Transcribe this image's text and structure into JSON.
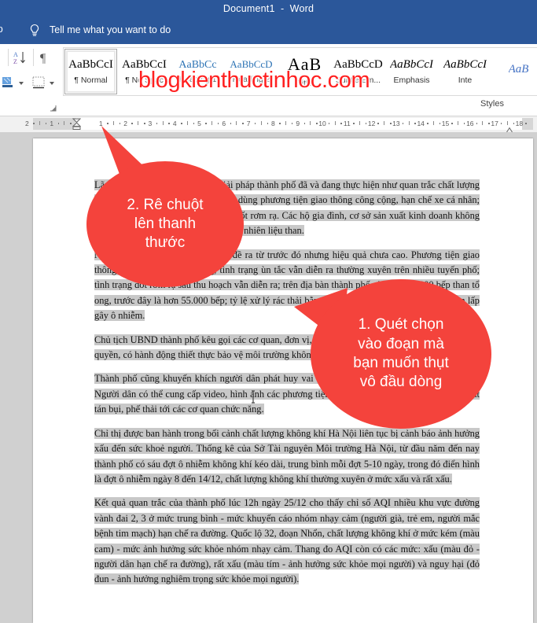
{
  "titlebar": {
    "title": "Document1  -  Word"
  },
  "tellme": {
    "help_tab_label": "lp",
    "bulb_icon": "lightbulb-icon",
    "placeholder": "Tell me what you want to do"
  },
  "ribbon": {
    "group_caption": "Styles",
    "left_icons": [
      {
        "name": "sort-az-icon",
        "label": "Sort"
      },
      {
        "name": "show-formatting-marks-icon",
        "label": "¶"
      },
      {
        "name": "shading-icon",
        "label": "Shading"
      },
      {
        "name": "borders-icon",
        "label": "Borders"
      }
    ],
    "styles": [
      {
        "preview": "AaBbCcI",
        "label": "¶ Normal",
        "variant": "normal",
        "selected": true
      },
      {
        "preview": "AaBbCcI",
        "label": "¶ No Spac",
        "variant": "normal",
        "selected": false
      },
      {
        "preview": "AaBbCc",
        "label": "Heading 1",
        "variant": "heading1",
        "selected": false
      },
      {
        "preview": "AaBbCcD",
        "label": "Heading 2",
        "variant": "heading2",
        "selected": false
      },
      {
        "preview": "AaB",
        "label": "Title",
        "variant": "title",
        "selected": false
      },
      {
        "preview": "AaBbCcD",
        "label": "Subtle Em...",
        "variant": "normal",
        "selected": false
      },
      {
        "preview": "AaBbCcI",
        "label": "Emphasis",
        "variant": "italic",
        "selected": false
      },
      {
        "preview": "AaBbCcI",
        "label": "Inte",
        "variant": "italic",
        "selected": false
      },
      {
        "preview": "AaB",
        "label": "",
        "variant": "blue",
        "selected": false
      }
    ]
  },
  "ruler": {
    "left_numbers": [
      "2",
      "1"
    ],
    "numbers": [
      "1",
      "2",
      "3",
      "4",
      "5",
      "6",
      "7",
      "8",
      "9",
      "10",
      "11",
      "12",
      "13",
      "14",
      "15",
      "16",
      "17",
      "18"
    ],
    "first_line_indent_marker": "hourglass-indent-marker",
    "right_indent_marker": "right-indent-marker"
  },
  "document": {
    "paragraphs": [
      "Lãnh đạo thành phố nêu những giải pháp thành phố đã và đang thực hiện như quan trắc chất lượng không khí; khuyến khích người dân dùng phương tiện giao thông công cộng, hạn chế xe cá nhân; vận động người dân không đốt rác, đốt rơm rạ. Các hộ gia đình, cơ sở sản xuất kinh doanh không sử dụng bếp than tổ ong hoặc các loại nhiên liệu than.",
      "Nhưng nhiều giải pháp thành phố đề ra từ trước đó nhưng hiệu quả chưa cao. Phương tiện giao thông cá nhân ngày càng tăng, tình trạng ùn tắc vẫn diễn ra thường xuyên trên nhiều tuyến phố; tình trạng đốt rơm rạ sau thu hoạch vẫn diễn ra; trên địa bàn thành phố còn trên 22.000 bếp than tổ ong, trước đây là hơn 55.000 bếp; tỷ lệ xử lý rác thải bằng chôn lấp vẫn chiếm đa số, nơi chôn lấp gây ô nhiễm.",
      "Chủ tịch UBND thành phố kêu gọi các cơ quan, đơn vị, người dân ủng hộ các biện pháp của chính quyền, có hành động thiết thực bảo vệ môi trường không khí của thành phố.",
      "Thành phố cũng khuyến khích người dân phát huy vai trò giám sát các hoạt động gây ô nhiễm. Người dân có thể cung cấp video, hình ảnh các phương tiện chở vật liệu không che chắn gây phát tán bụi, phế thải tới các cơ quan chức năng.",
      "Chỉ thị được ban hành trong bối cảnh chất lượng không khí Hà Nội liên tục bị cảnh báo ảnh hưởng xấu đến sức khoẻ người. Thống kê của Sở Tài nguyên Môi trường Hà Nội, từ đầu năm đến nay thành phố có sáu đợt ô nhiễm không khí kéo dài, trung bình mỗi đợt 5-10 ngày, trong đó điển hình là đợt ô nhiễm ngày 8 đến 14/12, chất lượng không khí thường xuyên ở mức xấu và rất xấu.",
      "Kết quả quan trắc của thành phố lúc 12h ngày 25/12 cho thấy chỉ số AQI nhiều khu vực đường vành đai 2, 3 ở mức trung bình - mức khuyến cáo nhóm nhạy cảm (người già, trẻ em, người mắc bệnh tim mạch) hạn chế ra đường. Quốc lộ 32, đoạn Nhổn, chất lượng không khí ở mức kém (màu cam) - mức ảnh hưởng sức khỏe nhóm nhạy cảm. Thang đo AQI còn có các mức: xấu (màu đỏ - người dân hạn chế ra đường), rất xấu (màu tím - ảnh hưởng sức khỏe mọi người) và nguy hại (đỏ đun - ảnh hưởng nghiêm trọng sức khỏe mọi người)."
    ],
    "cursor_icon": "text-ibeam-cursor"
  },
  "callouts": [
    {
      "id": "callout-2",
      "text": "2. Rê chuột\nlên thanh\nthước",
      "color": "#f4433c"
    },
    {
      "id": "callout-1",
      "text": "1. Quét chọn\nvào đoạn mà\nbạn muốn thụt\nvô đầu dòng",
      "color": "#f4433c"
    }
  ],
  "watermark": {
    "text": "blogkienthuctinhoc.com",
    "color": "#ff2020"
  },
  "colors": {
    "titlebar_bg": "#2b579a",
    "callout_red": "#f4433c",
    "selection_gray": "#c8c8c8",
    "canvas_gray": "#d0d0d0"
  }
}
